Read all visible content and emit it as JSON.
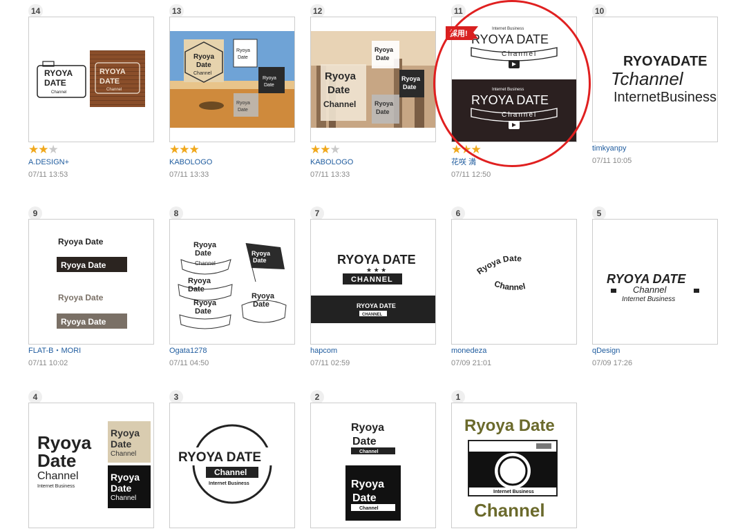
{
  "entries": [
    {
      "num": "14",
      "author": "A.DESIGN+",
      "date": "07/11 13:53",
      "stars": 2
    },
    {
      "num": "13",
      "author": "KABOLOGO",
      "date": "07/11 13:33",
      "stars": 3
    },
    {
      "num": "12",
      "author": "KABOLOGO",
      "date": "07/11 13:33",
      "stars": 2
    },
    {
      "num": "11",
      "author": "花咲 満",
      "date": "07/11 12:50",
      "stars": 3,
      "badge": "採用!"
    },
    {
      "num": "10",
      "author": "timkyanpy",
      "date": "07/11 10:05",
      "stars": 0
    },
    {
      "num": "9",
      "author": "FLAT-B・MORI",
      "date": "07/11 10:02",
      "stars": 0
    },
    {
      "num": "8",
      "author": "Ogata1278",
      "date": "07/11 04:50",
      "stars": 0
    },
    {
      "num": "7",
      "author": "hapcom",
      "date": "07/11 02:59",
      "stars": 0
    },
    {
      "num": "6",
      "author": "monedeza",
      "date": "07/09 21:01",
      "stars": 0
    },
    {
      "num": "5",
      "author": "qDesign",
      "date": "07/09 17:26",
      "stars": 0
    },
    {
      "num": "4",
      "stars": 0
    },
    {
      "num": "3",
      "stars": 0
    },
    {
      "num": "2",
      "stars": 0
    },
    {
      "num": "1",
      "stars": 0
    }
  ],
  "logo_text": {
    "ryoya": "Ryoya",
    "date": "Date",
    "channel": "Channel",
    "ryoya_date_caps": "RYOYA DATE",
    "channel_caps": "CHANNEL",
    "internet_business": "Internet Business",
    "internet_business_joined": "InternetBusiness",
    "ryoya_caps": "RYOYA",
    "date_caps": "DATE",
    "ryoyadate_caps": "RYOYADATE",
    "tchannel": "Tchannel",
    "channel_spaced": "Channel",
    "ryoya_date": "Ryoya Date"
  },
  "colors": {
    "author_link": "#1e5b9e",
    "star_on": "#f0a81c",
    "star_off": "#c9c9c9",
    "badge": "#d82020",
    "highlight_circle": "#e02020"
  }
}
